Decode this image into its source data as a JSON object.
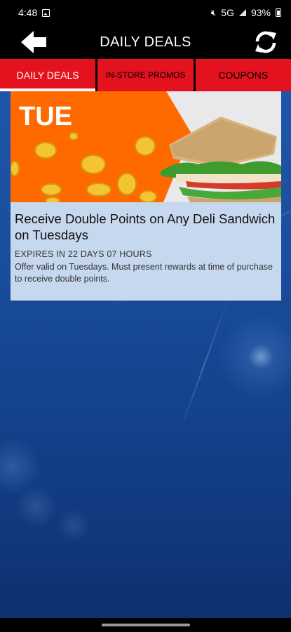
{
  "status_bar": {
    "time": "4:48",
    "network": "5G",
    "battery": "93%",
    "icons": [
      "image-icon",
      "mute-icon",
      "signal-icon",
      "battery-icon"
    ]
  },
  "header": {
    "title": "DAILY DEALS",
    "back_icon": "arrow-left-icon",
    "refresh_icon": "refresh-icon"
  },
  "tabs": [
    {
      "label": "DAILY DEALS",
      "active": true
    },
    {
      "label": "IN-STORE PROMOS",
      "active": false
    },
    {
      "label": "COUPONS",
      "active": false
    }
  ],
  "deal": {
    "banner_day": "TUE",
    "title": "Receive Double Points on Any Deli Sandwich on Tuesdays",
    "expiry": "EXPIRES IN 22 DAYS 07 HOURS",
    "description": "Offer valid on Tuesdays. Must present rewards at time of purchase to receive double points."
  },
  "colors": {
    "tab_red": "#e4121f",
    "banner_orange": "#ff6a00",
    "card_bg": "#c6d8ee",
    "background_blue": "#1a4e9e"
  }
}
